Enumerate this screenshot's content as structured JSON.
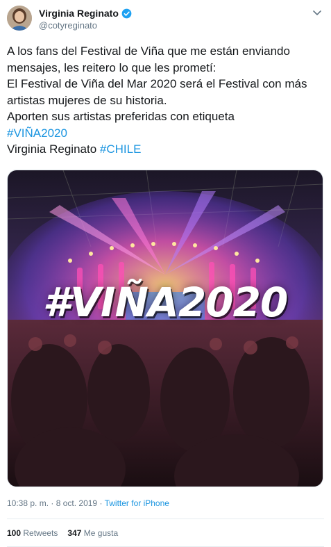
{
  "user": {
    "display_name": "Virginia Reginato",
    "handle": "@cotyreginato",
    "verified": true
  },
  "tweet": {
    "lines": [
      "A los fans del Festival de Viña que me están enviando mensajes, les reitero lo que les prometí:",
      "El Festival de Viña del Mar 2020 será el Festival con más artistas mujeres de su historia.",
      "Aporten  sus artistas preferidas con etiqueta"
    ],
    "hashtag1": "#VIÑA2020",
    "signature": "Virginia Reginato",
    "hashtag2": "#CHILE"
  },
  "media": {
    "overlay_text": "#VIÑA2020"
  },
  "meta": {
    "time": "10:38 p. m.",
    "separator": " · ",
    "date": "8 oct. 2019",
    "source": "Twitter for iPhone"
  },
  "stats": {
    "retweets_count": "100",
    "retweets_label": "Retweets",
    "likes_count": "347",
    "likes_label": "Me gusta"
  },
  "colors": {
    "link": "#1b95e0",
    "secondary_text": "#657786",
    "divider": "#e6ecf0"
  },
  "icons": [
    "verified-badge-icon",
    "chevron-down-icon"
  ]
}
